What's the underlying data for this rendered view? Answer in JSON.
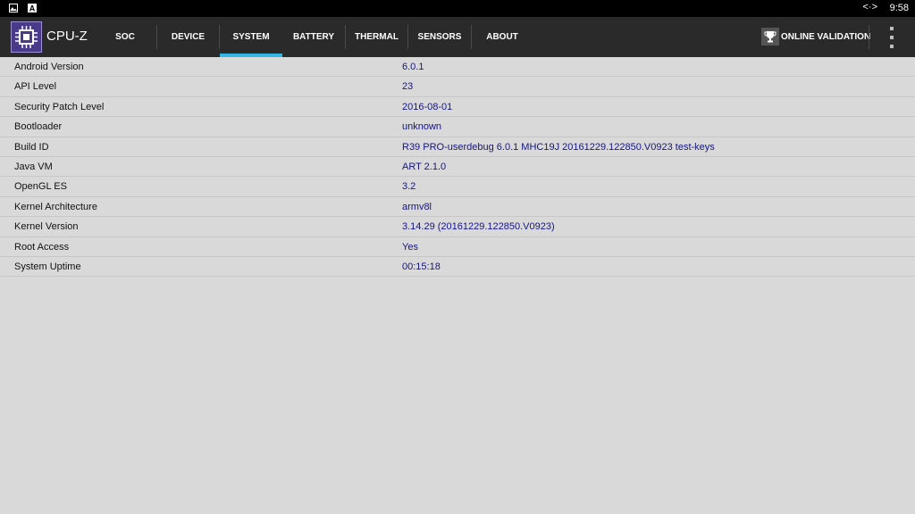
{
  "statusbar": {
    "time": "9:58",
    "sync_glyph": "<·>",
    "icons": [
      "image-icon",
      "a-icon"
    ]
  },
  "app": {
    "title": "CPU-Z",
    "logo_icon": "chip-icon",
    "colors": {
      "accent": "#33b5e5",
      "value_text": "#14148a",
      "logo_bg": "#4a3a8c"
    }
  },
  "tabs": [
    {
      "label": "SOC",
      "active": false
    },
    {
      "label": "DEVICE",
      "active": false
    },
    {
      "label": "SYSTEM",
      "active": true
    },
    {
      "label": "BATTERY",
      "active": false
    },
    {
      "label": "THERMAL",
      "active": false
    },
    {
      "label": "SENSORS",
      "active": false
    },
    {
      "label": "ABOUT",
      "active": false
    }
  ],
  "actions": {
    "validation_label": "ONLINE VALIDATION",
    "validation_icon": "trophy-icon",
    "menu_icon": "overflow-menu-icon"
  },
  "rows": [
    {
      "label": "Android Version",
      "value": "6.0.1"
    },
    {
      "label": "API Level",
      "value": "23"
    },
    {
      "label": "Security Patch Level",
      "value": "2016-08-01"
    },
    {
      "label": "Bootloader",
      "value": "unknown"
    },
    {
      "label": "Build ID",
      "value": "R39 PRO-userdebug 6.0.1 MHC19J 20161229.122850.V0923 test-keys"
    },
    {
      "label": "Java VM",
      "value": "ART 2.1.0"
    },
    {
      "label": "OpenGL ES",
      "value": "3.2"
    },
    {
      "label": "Kernel Architecture",
      "value": "armv8l"
    },
    {
      "label": "Kernel Version",
      "value": "3.14.29 (20161229.122850.V0923)"
    },
    {
      "label": "Root Access",
      "value": "Yes"
    },
    {
      "label": "System Uptime",
      "value": "00:15:18"
    }
  ]
}
